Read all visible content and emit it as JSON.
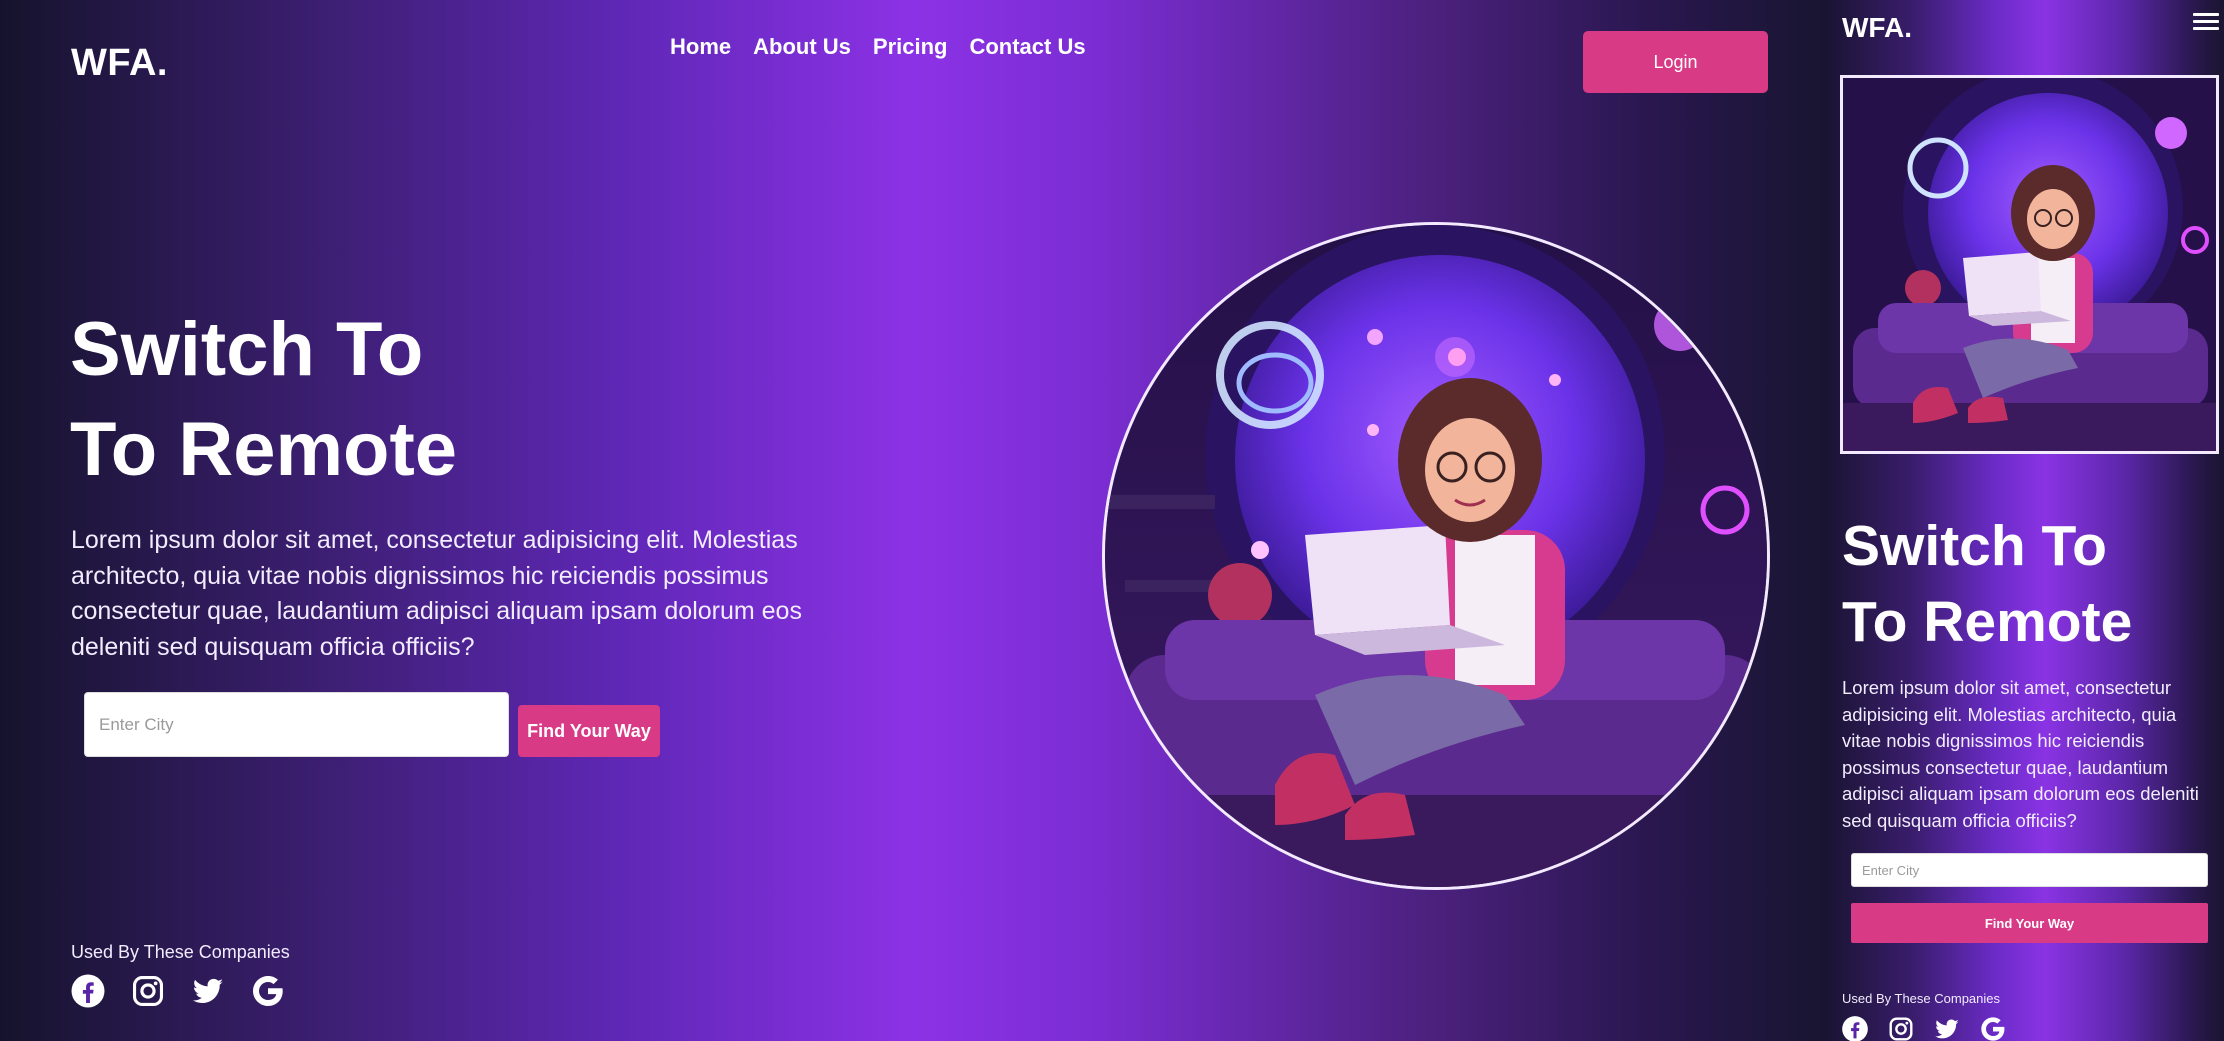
{
  "brand": {
    "logo": "WFA."
  },
  "nav": {
    "items": [
      "Home",
      "About Us",
      "Pricing",
      "Contact Us"
    ]
  },
  "header": {
    "login_label": "Login"
  },
  "hero": {
    "title_line1": "Switch To",
    "title_line2": "To Remote",
    "description": "Lorem ipsum dolor sit amet, consectetur adipisicing elit. Molestias architecto, quia vitae nobis dignissimos hic reiciendis possimus consectetur quae, laudantium adipisci aliquam ipsam dolorum eos deleniti sed quisquam officia officiis?",
    "city_placeholder": "Enter City",
    "find_label": "Find Your Way",
    "image_icon": "woman-with-laptop-illustration"
  },
  "companies": {
    "label": "Used By These Companies",
    "icons": [
      "facebook-icon",
      "instagram-icon",
      "twitter-icon",
      "google-icon"
    ]
  },
  "mobile": {
    "menu_icon": "hamburger-menu-icon"
  },
  "colors": {
    "accent": "#d93a86",
    "purple": "#8c32e6",
    "dark": "#15132c"
  }
}
